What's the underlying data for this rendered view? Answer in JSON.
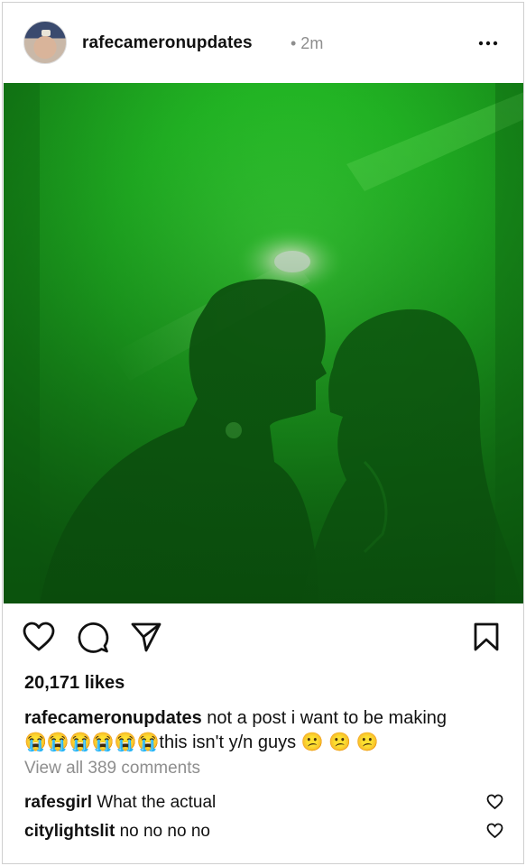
{
  "post": {
    "username": "rafecameronupdates",
    "time": "• 2m",
    "likes": "20,171 likes",
    "caption_user": "rafecameronupdates",
    "caption_text_line1": " not a post i want to be making",
    "caption_emojis_sad": "😭😭😭😭😭😭",
    "caption_text_line2": "this isn't y/n guys",
    "caption_emojis_confused": "😕 😕 😕",
    "view_all": "View all 389 comments"
  },
  "comments": [
    {
      "user": "rafesgirl",
      "text": " What the actual"
    },
    {
      "user": "citylightslit",
      "text": " no no no no"
    }
  ],
  "colors": {
    "photo_green": "#1fb322",
    "muted_text": "#8e8e8e"
  },
  "icons": [
    "more-icon",
    "like-icon",
    "comment-icon",
    "share-icon",
    "save-icon",
    "heart-icon"
  ]
}
